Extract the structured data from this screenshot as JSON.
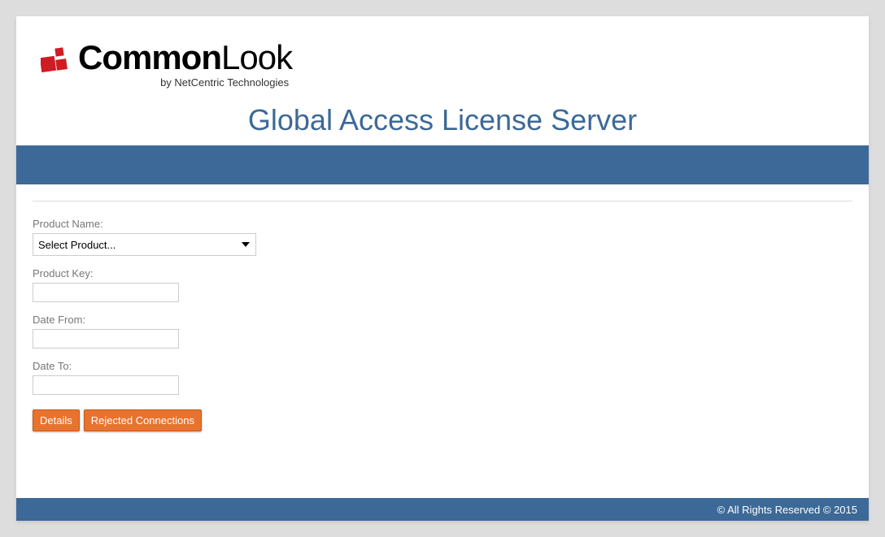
{
  "logo": {
    "text_bold": "Common",
    "text_light": "Look",
    "tagline": "by NetCentric Technologies"
  },
  "page_title": "Global Access License Server",
  "form": {
    "product_name_label": "Product Name:",
    "product_name_selected": "Select Product...",
    "product_key_label": "Product Key:",
    "product_key_value": "",
    "date_from_label": "Date From:",
    "date_from_value": "",
    "date_to_label": "Date To:",
    "date_to_value": ""
  },
  "buttons": {
    "details": "Details",
    "rejected": "Rejected Connections"
  },
  "footer": {
    "copyright": "© All Rights Reserved © 2015"
  }
}
